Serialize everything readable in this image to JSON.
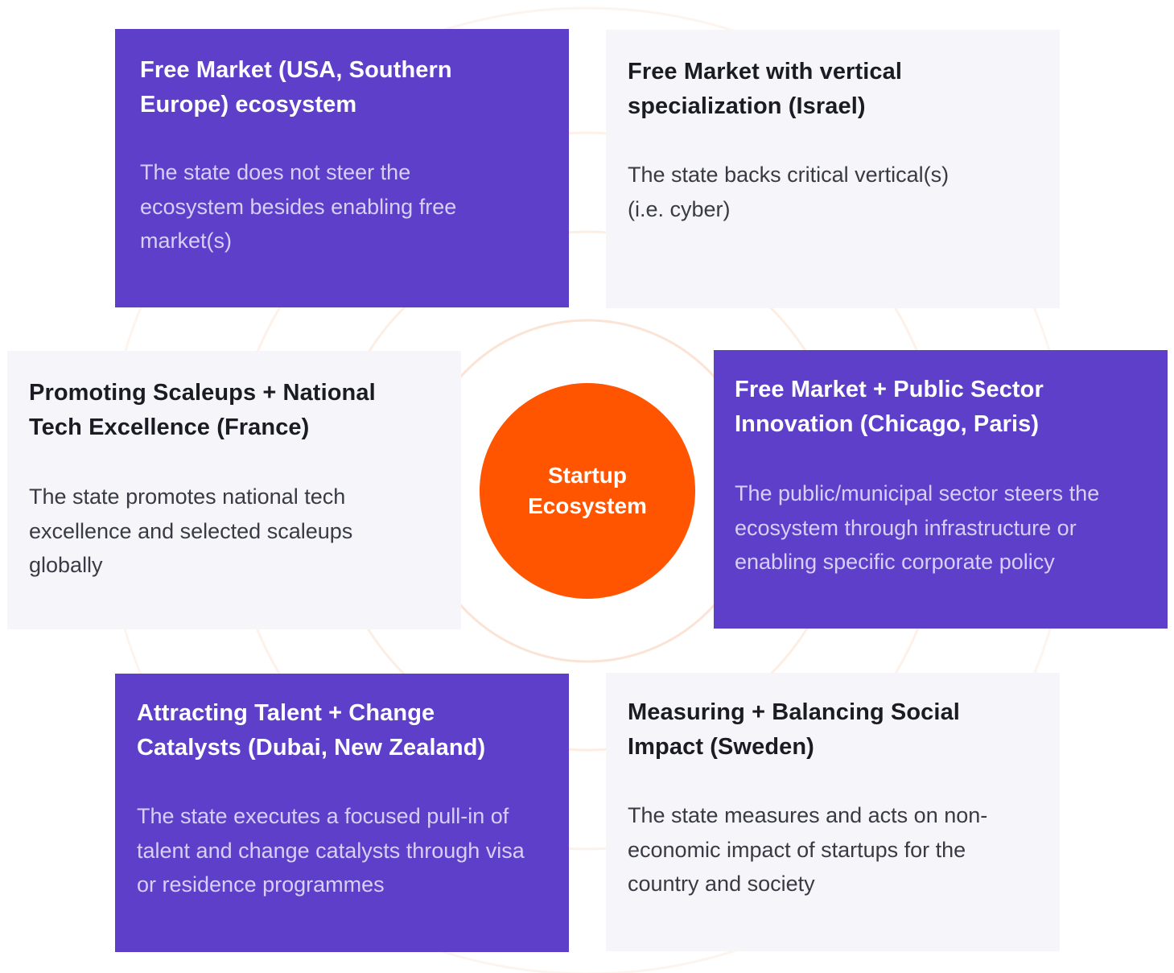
{
  "center": {
    "label": "Startup Ecosystem"
  },
  "cards": {
    "top_left": {
      "title": "Free Market (USA, Southern Europe) ecosystem",
      "description": "The state does not steer the ecosystem besides enabling free market(s)"
    },
    "top_right": {
      "title": "Free Market with vertical specialization (Israel)",
      "description": "The state backs critical vertical(s) (i.e. cyber)"
    },
    "middle_left": {
      "title": "Promoting Scaleups + National Tech Excellence (France)",
      "description": "The state promotes national tech excellence and selected scaleups globally"
    },
    "middle_right": {
      "title": "Free Market + Public Sector Innovation (Chicago, Paris)",
      "description": "The public/municipal sector steers the ecosystem through infrastructure or enabling specific corporate policy"
    },
    "bottom_left": {
      "title": "Attracting Talent + Change Catalysts (Dubai, New Zealand)",
      "description": "The state executes a focused pull-in of talent and change catalysts through visa or residence programmes"
    },
    "bottom_right": {
      "title": "Measuring + Balancing Social Impact (Sweden)",
      "description": "The state measures and acts on non-economic impact of startups for the country and society"
    }
  },
  "colors": {
    "purple_card": "#5d3fc9",
    "light_card": "#f5f5fa",
    "center_circle": "#ff5400",
    "ring_stroke": "#fbe4d6"
  }
}
